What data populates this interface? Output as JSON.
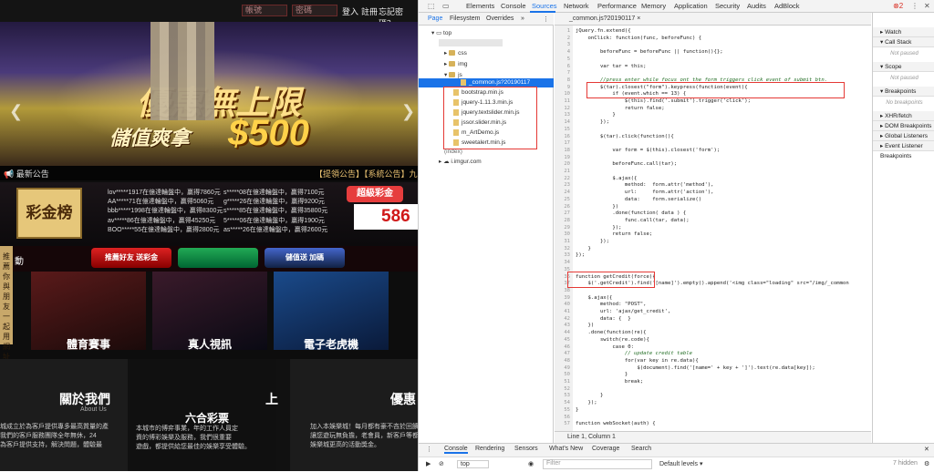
{
  "site": {
    "login_placeholders": [
      "帳號",
      "密碼"
    ],
    "top_links": [
      "登入",
      "註冊",
      "忘記密碼？"
    ],
    "banner": {
      "line1": "優惠無上限",
      "line2": "儲值爽拿",
      "amount": "$500"
    },
    "notice": {
      "tag": "最新公告",
      "text": "【提領公告】【系統公告】九"
    },
    "jackpot": {
      "badge": "彩金榜",
      "winners_left": [
        "lov*****1917在億達輪盤中，贏得7860元",
        "AA*****71在億達輪盤中，贏得5060元",
        "bbb*****1998在億達輪盤中，贏得8300元",
        "av*****86在億達輪盤中，贏得45250元",
        "BOO*****55在億達輪盤中，贏得2800元"
      ],
      "winners_right": [
        "s*****08在億達輪盤中，贏得7100元",
        "g*****26在億達輪盤中，贏得9200元",
        "s*****85在億達輪盤中，贏得35800元",
        "5*****06在億達輪盤中，贏得1900元",
        "as*****26在億達輪盤中，贏得2600元"
      ],
      "super_label": "超級彩金",
      "super_value": "586"
    },
    "promo": {
      "heading": "動",
      "buttons": [
        "推薦好友 送彩金",
        "",
        "儲值送 加碼"
      ]
    },
    "side_tab": "推薦你與朋友一起用網址",
    "cards": [
      {
        "label": "體育賽事"
      },
      {
        "label": "真人視訊"
      },
      {
        "label": "電子老虎機"
      }
    ],
    "bottom": {
      "about_title": "關於我們",
      "about_sub": "About Us",
      "about_text": "城成立於為客戶提供專多最高質量的產\n我們的客戶服務團隊全年無休，24\n為客戶提供支持，解決問題，體驗最",
      "lottery_label": "六合彩票",
      "lottery_text": "本城市的博弈事業，年的工作人員定\n資的博彩娛樂及服務，我們很重要\n遊戲，都提供給您最佳的娛樂享受體驗。",
      "mid_title": "上",
      "right_title": "優惠",
      "right_text": "加入本娛樂城！每月都有豪不吝於回饋\n讓您遊玩無負擔，老會員，新客戶等都享\n娛樂城更高的活動獎金。"
    }
  },
  "devtools": {
    "main_tabs": [
      "Elements",
      "Console",
      "Sources",
      "Network",
      "Performance",
      "Memory",
      "Application",
      "Security",
      "Audits",
      "AdBlock"
    ],
    "error_count": "2",
    "nav_tabs": [
      "Page",
      "Filesystem",
      "Overrides",
      "»"
    ],
    "tree": {
      "top": "top",
      "host": "",
      "folders": [
        "css",
        "img",
        "js"
      ],
      "selected": "_common.js?20190117",
      "files": [
        "bootstrap.min.js",
        "jquery-1.11.3.min.js",
        "jquery.textslider.min.js",
        "jssor.slider.min.js",
        "m_ArtDemo.js",
        "sweetalert.min.js"
      ],
      "index": "(index)",
      "imgur": "i.imgur.com"
    },
    "editor_tab": "_common.js?20190117 ×",
    "code_lines": [
      "jQuery.fn.extend({",
      "    onClick: function(func, beforeFunc) {",
      "",
      "        beforeFunc = beforeFunc || function(){};",
      "",
      "        var tar = this;",
      "",
      "        //press enter while focus ont the form triggers click event of submit btn.",
      "        $(tar).closest(\"form\").keypress(function(event){",
      "            if (event.which == 13) {",
      "                $(this).find('.submit').trigger('click');",
      "                return false;",
      "            }",
      "        });",
      "",
      "        $(tar).click(function(){",
      "",
      "            var form = $(this).closest('form');",
      "",
      "            beforeFunc.call(tar);",
      "",
      "            $.ajax({",
      "                method:  form.attr('method'),",
      "                url:     form.attr('action'),",
      "                data:    form.serialize()",
      "            })",
      "            .done(function( data ) {",
      "                func.call(tar, data);",
      "            });",
      "            return false;",
      "        });",
      "    }",
      "});",
      "",
      "",
      "function getCredit(force){",
      "    $('.getCredit').find('[name]').empty().append('<img class=\"loading\" src=\"/img/_common",
      "",
      "    $.ajax({",
      "        method: \"POST\",",
      "        url: 'ajax/get_credit',",
      "        data: {  }",
      "    })",
      "    .done(function(re){",
      "        switch(re.code){",
      "            case 0:",
      "                // update credit table",
      "                for(var key in re.data){",
      "                    $(document).find('[name=' + key + ']').text(re.data[key]);",
      "                }",
      "                break;",
      "",
      "        }",
      "    });",
      "}",
      "",
      "function webSocket(auth) {"
    ],
    "status_text": "Line 1, Column 1",
    "debug": {
      "sections": [
        "Watch",
        "Call Stack",
        "Scope",
        "Breakpoints",
        "XHR/fetch Breakpoints",
        "DOM Breakpoints",
        "Global Listeners",
        "Event Listener Breakpoints"
      ],
      "not_paused": "Not paused",
      "no_breakpoints": "No breakpoints"
    },
    "drawer_tabs": [
      "Console",
      "Rendering",
      "Sensors",
      "What's New",
      "Coverage",
      "Search"
    ],
    "console_context": "top",
    "filter_placeholder": "Filter",
    "levels": "Default levels ▾",
    "hidden": "7 hidden"
  }
}
